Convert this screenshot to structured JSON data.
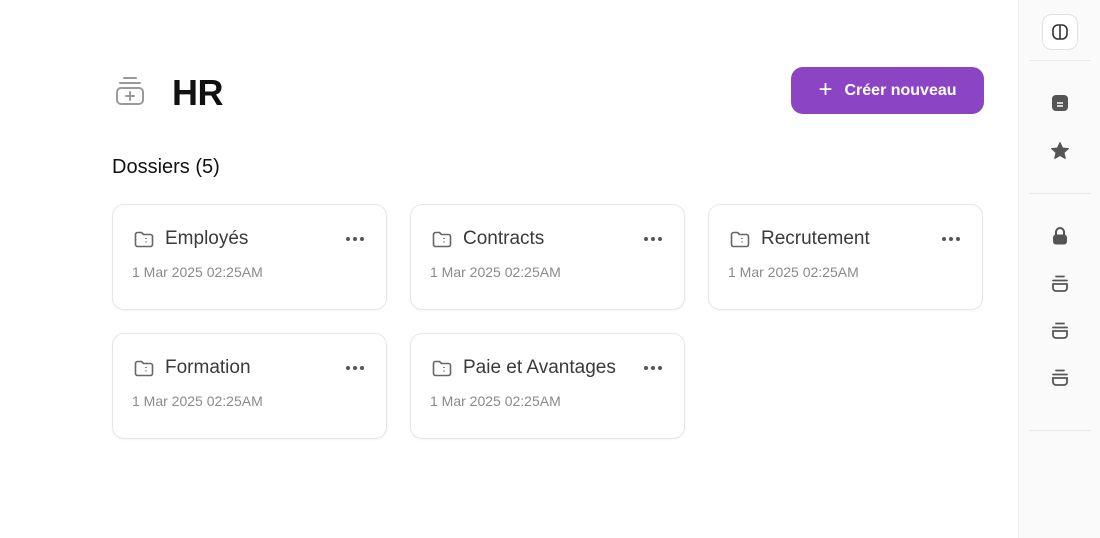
{
  "header": {
    "title": "HR",
    "create_button_label": "Créer nouveau",
    "create_button_icon": "plus-icon"
  },
  "colors": {
    "accent": "#8b45c4",
    "text": "#111111",
    "muted": "#8a8a8a"
  },
  "folders": {
    "heading": "Dossiers (5)",
    "items": [
      {
        "name": "Employés",
        "date": "1 Mar 2025 02:25AM"
      },
      {
        "name": "Contracts",
        "date": "1 Mar 2025 02:25AM"
      },
      {
        "name": "Recrutement",
        "date": "1 Mar 2025 02:25AM"
      },
      {
        "name": "Formation",
        "date": "1 Mar 2025 02:25AM"
      },
      {
        "name": "Paie et Avantages",
        "date": "1 Mar 2025 02:25AM"
      }
    ]
  },
  "sidebar": {
    "icons": [
      "panel-toggle-icon",
      "document-icon",
      "star-icon",
      "lock-icon",
      "bowl-icon",
      "bowl-icon",
      "bowl-icon"
    ]
  }
}
